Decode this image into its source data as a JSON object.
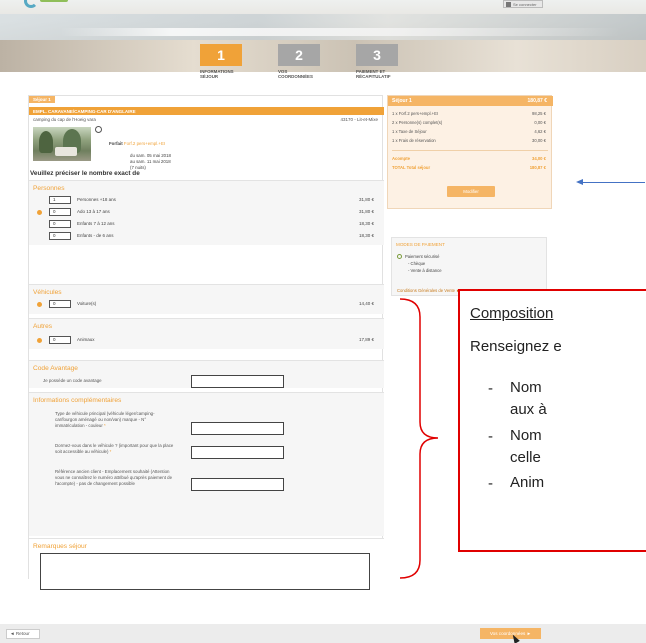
{
  "header": {
    "connexion_label": "Se connecter"
  },
  "steps": [
    {
      "num": "1",
      "label": "Informations séjour"
    },
    {
      "num": "2",
      "label": "Vos coordonnées"
    },
    {
      "num": "3",
      "label": "Paiement et récapitulatif"
    }
  ],
  "booking": {
    "tag": "Séjour 1",
    "camping_type": "EMPL. CARAVANE/CAMPING-CAR D'ANGLAIRE",
    "camping_name": "camping du cap de l'Hoeig vara",
    "location": "43170 - Lit-et-Mixe",
    "forfait_label": "Forfait",
    "forfait_value": "Forf.2 pers+empl.+EI",
    "date_from": "du sam. 05 mai 2018",
    "date_to": "au sam. 11 mai 2018",
    "nights": "(7 nuits)",
    "precisez": "Veuillez préciser le nombre exact de"
  },
  "personnes": {
    "title": "Personnes",
    "rows": [
      {
        "qty": "1",
        "label": "Personnes +18 ans",
        "price": "31,80 €"
      },
      {
        "qty": "0",
        "label": "Ado 13 à 17 ans",
        "price": "31,80 €"
      },
      {
        "qty": "0",
        "label": "Enfants 7 à 12 ans",
        "price": "18,30 €"
      },
      {
        "qty": "0",
        "label": "Enfants - de 6 ans",
        "price": "18,30 €"
      }
    ]
  },
  "vehicules": {
    "title": "Véhicules",
    "rows": [
      {
        "qty": "0",
        "label": "Voiture(s)",
        "price": "14,40 €"
      }
    ]
  },
  "autres": {
    "title": "Autres",
    "rows": [
      {
        "qty": "0",
        "label": "Animaux",
        "price": "17,89 €"
      }
    ]
  },
  "code_avantage": {
    "title": "Code Avantage",
    "label": "Je possède un code avantage"
  },
  "infos": {
    "title": "Informations complémentaires",
    "q1": "Type de véhicule principal (véhicule léger/camping-car/fourgon aménagé ou non/van) marque - N° immatriculation - couleur",
    "q2": "Dormez-vous dans le véhicule ? (important pour que la place soit accessible au véhicule)",
    "q3": "Référence ancien client - Emplacement souhaité (Attention vous ne connaîtrez le numéro attribué qu'après paiement de l'acompte) - pas de changement possible"
  },
  "remarques": {
    "title": "Remarques séjour"
  },
  "summary": {
    "title": "Séjour 1",
    "total": "180,87 €",
    "rows": [
      {
        "label": "1 x Forf.2 pers+empl.+EI",
        "value": "98,25 €"
      },
      {
        "label": "2 x Personne(s) complet(s)",
        "value": "0,00 €"
      },
      {
        "label": "1 x Taxe de Séjour",
        "value": "4,62 €"
      },
      {
        "label": "1 x Frais de réservation",
        "value": "30,00 €"
      }
    ],
    "acompte_label": "Acompte",
    "acompte_value": "34,00 €",
    "total_label": "TOTAL Total séjour",
    "total_value": "180,87 €",
    "modify_label": "Modifier"
  },
  "payment": {
    "title": "Modes de paiement",
    "option": "Paiement sécurisé",
    "sub1": "- Chèque",
    "sub2": "- Vente à distance",
    "cgv": "Conditions Générales de Vente ►"
  },
  "overlay": {
    "title": "Composition",
    "intro": "Renseignez e",
    "items": [
      "Nom",
      "aux à",
      "Nom",
      "celle",
      "Anim"
    ]
  },
  "footer": {
    "back_label": "◄ Retour",
    "next_label": "Vos coordonnées ►"
  },
  "colors": {
    "accent": "#f0a238",
    "annotation_red": "#e00000",
    "arrow_blue": "#4472c4"
  }
}
